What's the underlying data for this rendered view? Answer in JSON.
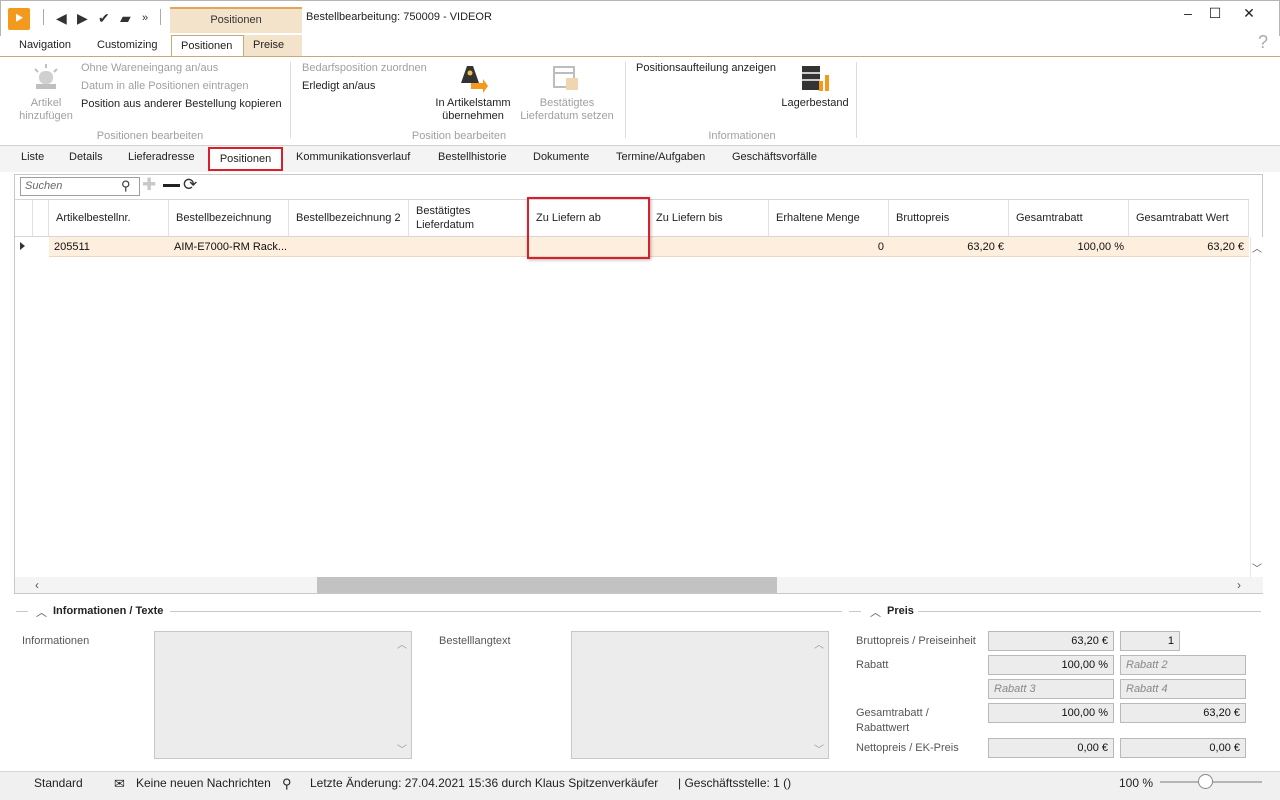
{
  "titlebar": {
    "context_tab_header": "Positionen",
    "window_title": "Bestellbearbeitung: 750009 - VIDEOR"
  },
  "ribbon_tabs": [
    "Navigation",
    "Customizing",
    "Positionen",
    "Preise"
  ],
  "ribbon": {
    "group1": {
      "big_button": "Artikel\nhinzufügen",
      "items": [
        "Ohne Wareneingang an/aus",
        "Datum in alle Positionen eintragen",
        "Position aus anderer Bestellung kopieren"
      ],
      "label": "Positionen bearbeiten"
    },
    "group2": {
      "items": [
        "Bedarfsposition zuordnen",
        "Erledigt an/aus"
      ],
      "big_button1": "In Artikelstamm\nübernehmen",
      "big_button2": "Bestätigtes\nLieferdatum setzen",
      "label": "Position bearbeiten"
    },
    "group3": {
      "items": [
        "Positionsaufteilung anzeigen"
      ],
      "big_button": "Lagerbestand",
      "label": "Informationen"
    }
  },
  "sub_tabs": [
    "Liste",
    "Details",
    "Lieferadresse",
    "Positionen",
    "Kommunikationsverlauf",
    "Bestellhistorie",
    "Dokumente",
    "Termine/Aufgaben",
    "Geschäftsvorfälle"
  ],
  "search": {
    "placeholder": "Suchen"
  },
  "grid": {
    "columns": [
      "Artikelbestellnr.",
      "Bestellbezeichnung",
      "Bestellbezeichnung 2",
      "Bestätigtes Lieferdatum",
      "Zu Liefern ab",
      "Zu Liefern bis",
      "Erhaltene Menge",
      "Bruttopreis",
      "Gesamtrabatt",
      "Gesamtrabatt Wert"
    ],
    "rows": [
      [
        "205511",
        "AIM-E7000-RM Rack...",
        "",
        "",
        "",
        "",
        "0",
        "63,20 €",
        "100,00 %",
        "63,20 €"
      ]
    ]
  },
  "info_panel": {
    "title": "Informationen / Texte",
    "informationen_label": "Informationen",
    "bestelllangtext_label": "Bestelllangtext"
  },
  "price_panel": {
    "title": "Preis",
    "bruttopreis_label": "Bruttopreis / Preiseinheit",
    "bruttopreis_value": "63,20 €",
    "preiseinheit_value": "1",
    "rabatt_label": "Rabatt",
    "rabatt1_value": "100,00 %",
    "rabatt2_placeholder": "Rabatt 2",
    "rabatt3_placeholder": "Rabatt 3",
    "rabatt4_placeholder": "Rabatt 4",
    "gesamtrabatt_label": "Gesamtrabatt /\nRabattwert",
    "gesamtrabatt_value": "100,00 %",
    "rabattwert_value": "63,20 €",
    "netto_label": "Nettopreis / EK-Preis",
    "netto_value": "0,00 €",
    "ek_value": "0,00 €"
  },
  "statusbar": {
    "layout": "Standard",
    "messages": "Keine neuen Nachrichten",
    "last_change": "Letzte Änderung: 27.04.2021 15:36 durch Klaus Spitzenverkäufer",
    "branch": "| Geschäftsstelle:  1 ()",
    "zoom": "100 %",
    "zoom_fraction": 0.45
  },
  "colors": {
    "accent_orange": "#f39a1e",
    "context_tab": "#f4e3cb",
    "highlight_red": "#d9202a",
    "selected_row": "#fdeedd"
  }
}
